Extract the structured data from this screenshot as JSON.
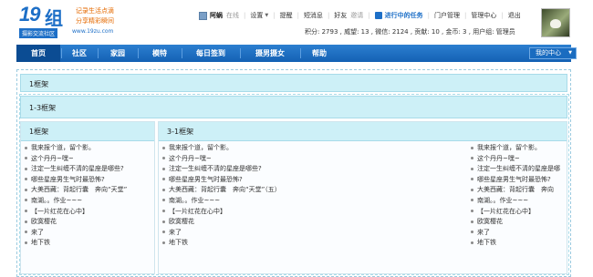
{
  "logo": {
    "number": "19",
    "char": "组",
    "tagline1": "记录生活点滴",
    "tagline2": "分享精彩瞬间",
    "subtitle": "摄影交流社区",
    "url": "www.19zu.com"
  },
  "userbar": {
    "username": "阿蜗",
    "status": "在线",
    "settings": "设置",
    "links": [
      "提醒",
      "短消息",
      "好友"
    ],
    "invite": "邀请",
    "task": "进行中的任务",
    "admin_links": [
      "门户管理",
      "管理中心",
      "退出"
    ]
  },
  "stats": {
    "text": "积分: 2793 , 威望: 13 , 微信: 2124 , 贡献: 10 , 金币: 3 , 用户组: 管理员"
  },
  "nav": {
    "items": [
      "首页",
      "社区",
      "家园",
      "模特",
      "每日签到",
      "摄男摄女",
      "帮助"
    ],
    "active_index": 0,
    "my_center": "我的中心"
  },
  "frames": {
    "frame1_title": "1框架",
    "frame13_title": "1-3框架",
    "col_a_title": "1框架",
    "col_b_title": "3-1框架"
  },
  "lists": {
    "col_a": [
      "我来报个道，留个影。",
      "这个丹丹~嘿~",
      "注定一生纠缠不清的星座是哪些?",
      "哪些星座男生气时最恐怖?",
      "大美西藏：背起行囊　奔向“天堂”",
      "南湖。。作业~~~",
      "【一片红花在心中】",
      "欧寞樱花",
      "来了",
      "地下铁"
    ],
    "col_b": [
      "我来报个道，留个影。",
      "这个丹丹~嘿~",
      "注定一生纠缠不清的星座是哪些?",
      "哪些星座男生气时最恐怖?",
      "大美西藏：背起行囊　奔向“天堂”（五）",
      "南湖。。作业~~~",
      "【一片红花在心中】",
      "欧寞樱花",
      "来了",
      "地下铁"
    ],
    "col_c": [
      "我来报个道，留个影。",
      "这个丹丹~嘿~",
      "注定一生纠缠不清的星座是哪",
      "哪些星座男生气时最恐怖?",
      "大美西藏：背起行囊　奔向",
      "南湖。。作业~~~",
      "【一片红花在心中】",
      "欧寞樱花",
      "来了",
      "地下铁"
    ]
  },
  "colors": {
    "brand": "#1d6fc7",
    "nav": "#1461b4",
    "frame": "#cdf0f7"
  }
}
